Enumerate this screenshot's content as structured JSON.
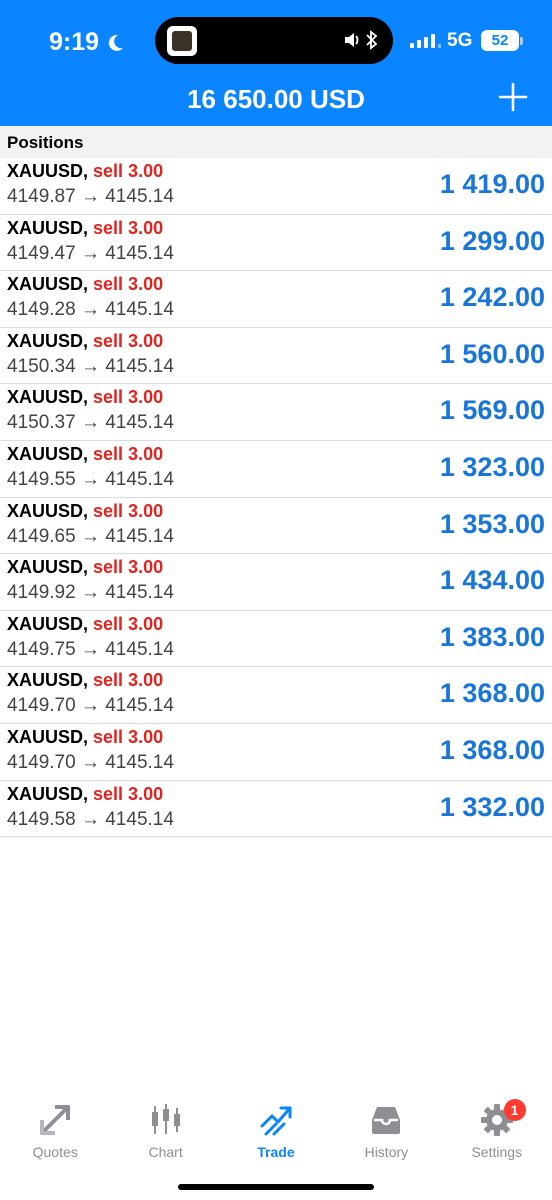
{
  "status": {
    "time": "9:19",
    "network": "5G",
    "battery": "52"
  },
  "header": {
    "balance": "16 650.00 USD"
  },
  "section": {
    "title": "Positions"
  },
  "positions": [
    {
      "symbol": "XAUUSD,",
      "side": "sell 3.00",
      "prices": "4149.87 → 4145.14",
      "profit": "1 419.00"
    },
    {
      "symbol": "XAUUSD,",
      "side": "sell 3.00",
      "prices": "4149.47 → 4145.14",
      "profit": "1 299.00"
    },
    {
      "symbol": "XAUUSD,",
      "side": "sell 3.00",
      "prices": "4149.28 → 4145.14",
      "profit": "1 242.00"
    },
    {
      "symbol": "XAUUSD,",
      "side": "sell 3.00",
      "prices": "4150.34 → 4145.14",
      "profit": "1 560.00"
    },
    {
      "symbol": "XAUUSD,",
      "side": "sell 3.00",
      "prices": "4150.37 → 4145.14",
      "profit": "1 569.00"
    },
    {
      "symbol": "XAUUSD,",
      "side": "sell 3.00",
      "prices": "4149.55 → 4145.14",
      "profit": "1 323.00"
    },
    {
      "symbol": "XAUUSD,",
      "side": "sell 3.00",
      "prices": "4149.65 → 4145.14",
      "profit": "1 353.00"
    },
    {
      "symbol": "XAUUSD,",
      "side": "sell 3.00",
      "prices": "4149.92 → 4145.14",
      "profit": "1 434.00"
    },
    {
      "symbol": "XAUUSD,",
      "side": "sell 3.00",
      "prices": "4149.75 → 4145.14",
      "profit": "1 383.00"
    },
    {
      "symbol": "XAUUSD,",
      "side": "sell 3.00",
      "prices": "4149.70 → 4145.14",
      "profit": "1 368.00"
    },
    {
      "symbol": "XAUUSD,",
      "side": "sell 3.00",
      "prices": "4149.70 → 4145.14",
      "profit": "1 368.00"
    },
    {
      "symbol": "XAUUSD,",
      "side": "sell 3.00",
      "prices": "4149.58 → 4145.14",
      "profit": "1 332.00"
    }
  ],
  "tabs": [
    {
      "label": "Quotes",
      "icon": "quotes-icon"
    },
    {
      "label": "Chart",
      "icon": "candlestick-icon"
    },
    {
      "label": "Trade",
      "icon": "trade-icon"
    },
    {
      "label": "History",
      "icon": "inbox-icon"
    },
    {
      "label": "Settings",
      "icon": "gear-icon",
      "badge": "1"
    }
  ],
  "colors": {
    "accent": "#0a84ff",
    "sell": "#e0241f",
    "profit": "#1976d8",
    "inactive_tab": "#8e8e93"
  }
}
